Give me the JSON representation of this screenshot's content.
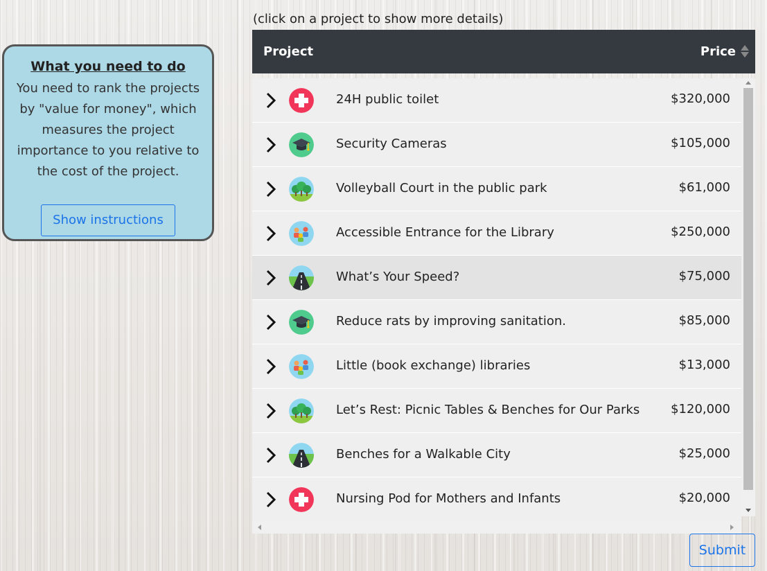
{
  "hint": "(click on a project to show more details)",
  "card": {
    "title": "What you need to do",
    "body": "You need to rank the projects by \"value for money\", which measures the project importance to you relative to the cost of the project.",
    "button": "Show instructions"
  },
  "table": {
    "col_project": "Project",
    "col_price": "Price",
    "rows": [
      {
        "name": "24H public toilet",
        "price": "$320,000",
        "icon": "health-cross-icon"
      },
      {
        "name": "Security Cameras",
        "price": "$105,000",
        "icon": "graduation-cap-icon"
      },
      {
        "name": "Volleyball Court in the public park",
        "price": "$61,000",
        "icon": "park-trees-icon"
      },
      {
        "name": "Accessible Entrance for the Library",
        "price": "$250,000",
        "icon": "community-people-icon"
      },
      {
        "name": "What’s Your Speed?",
        "price": "$75,000",
        "icon": "road-icon"
      },
      {
        "name": "Reduce rats by improving sanitation.",
        "price": "$85,000",
        "icon": "graduation-cap-icon"
      },
      {
        "name": "Little (book exchange) libraries",
        "price": "$13,000",
        "icon": "community-people-icon"
      },
      {
        "name": "Let’s Rest: Picnic Tables & Benches for Our Parks",
        "price": "$120,000",
        "icon": "park-trees-icon"
      },
      {
        "name": "Benches for a Walkable City",
        "price": "$25,000",
        "icon": "road-icon"
      },
      {
        "name": "Nursing Pod for Mothers and Infants",
        "price": "$20,000",
        "icon": "health-cross-icon"
      }
    ]
  },
  "submit": "Submit",
  "colors": {
    "header_bg": "#343a40",
    "card_bg": "#add8e6",
    "link_blue": "#1a73e8"
  }
}
